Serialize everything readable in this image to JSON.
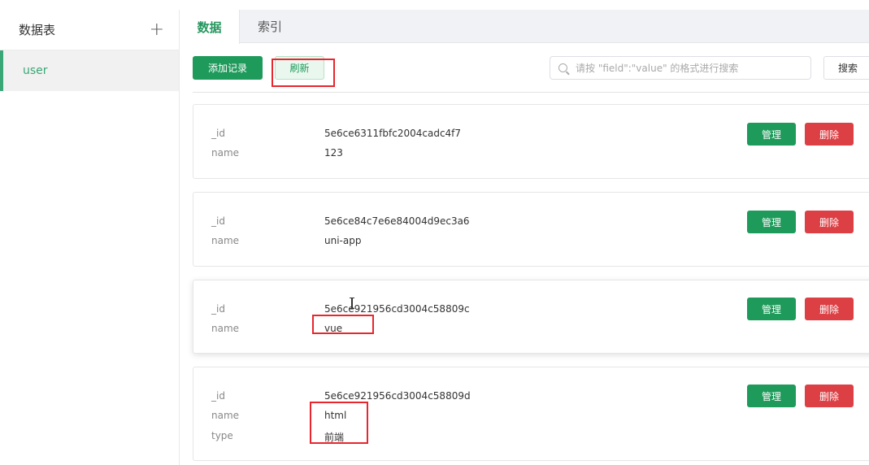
{
  "sidebar": {
    "title": "数据表",
    "add_icon": "plus-icon",
    "items": [
      {
        "label": "user"
      }
    ]
  },
  "tabs": [
    {
      "label": "数据",
      "active": true
    },
    {
      "label": "索引",
      "active": false
    }
  ],
  "toolbar": {
    "add_label": "添加记录",
    "refresh_label": "刷新",
    "search_placeholder": "请按 \"field\":\"value\" 的格式进行搜索",
    "search_label": "搜索"
  },
  "records": [
    {
      "fields": [
        {
          "key": "_id",
          "value": "5e6ce6311fbfc2004cadc4f7"
        },
        {
          "key": "name",
          "value": "123"
        }
      ],
      "manage_label": "管理",
      "delete_label": "删除"
    },
    {
      "fields": [
        {
          "key": "_id",
          "value": "5e6ce84c7e6e84004d9ec3a6"
        },
        {
          "key": "name",
          "value": "uni-app"
        }
      ],
      "manage_label": "管理",
      "delete_label": "删除"
    },
    {
      "fields": [
        {
          "key": "_id",
          "value": "5e6ce921956cd3004c58809c"
        },
        {
          "key": "name",
          "value": "vue"
        }
      ],
      "manage_label": "管理",
      "delete_label": "删除"
    },
    {
      "fields": [
        {
          "key": "_id",
          "value": "5e6ce921956cd3004c58809d"
        },
        {
          "key": "name",
          "value": "html"
        },
        {
          "key": "type",
          "value": "前端"
        }
      ],
      "manage_label": "管理",
      "delete_label": "删除"
    }
  ],
  "colors": {
    "primary": "#1e9a5a",
    "danger": "#dc3f44",
    "annotation": "#e8262e"
  }
}
